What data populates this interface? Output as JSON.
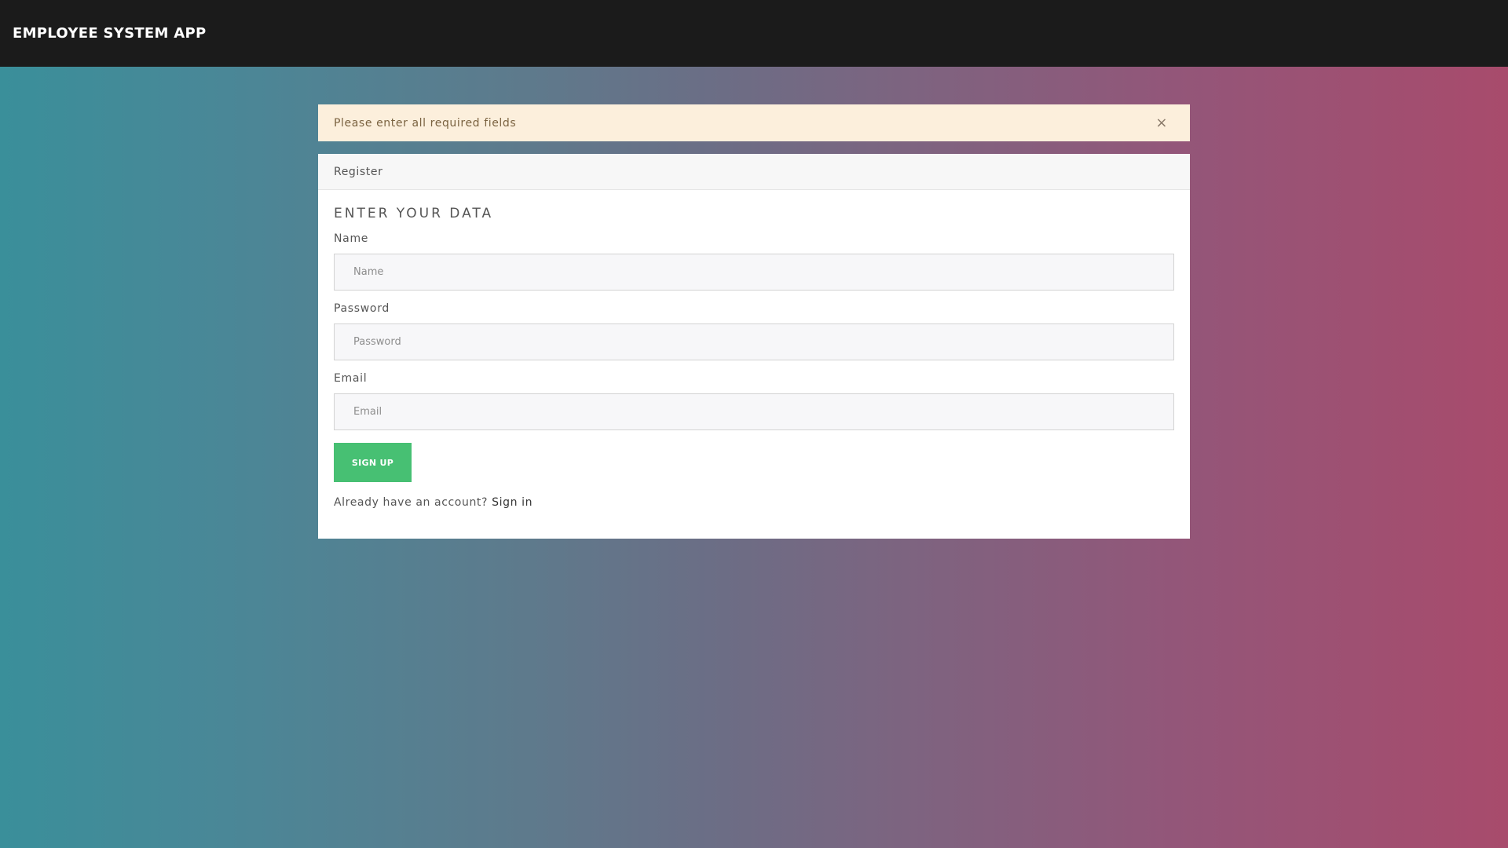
{
  "app": {
    "title": "EMPLOYEE SYSTEM APP"
  },
  "alert": {
    "message": "Please enter all required fields",
    "close_icon": "×"
  },
  "card": {
    "header": "Register",
    "title": "ENTER YOUR DATA",
    "fields": {
      "name": {
        "label": "Name",
        "placeholder": "Name",
        "value": ""
      },
      "password": {
        "label": "Password",
        "placeholder": "Password",
        "value": ""
      },
      "email": {
        "label": "Email",
        "placeholder": "Email",
        "value": ""
      }
    },
    "submit_label": "SIGN UP",
    "account_prompt": "Already have an account?",
    "signin_label": "Sign in"
  },
  "colors": {
    "navbar": "#1b1b1b",
    "alert_bg": "#fcefdc",
    "button": "#47c073"
  }
}
